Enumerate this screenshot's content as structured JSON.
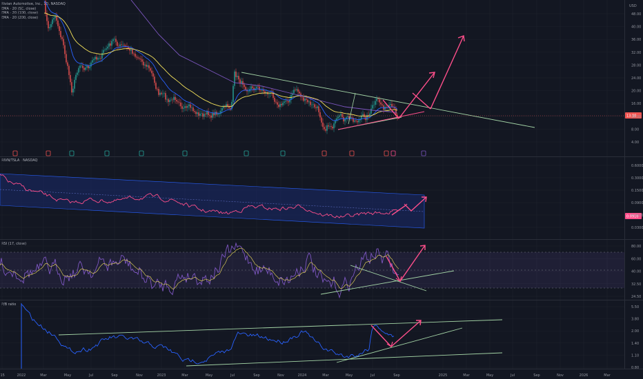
{
  "header": {
    "symbol_title": "Rivian Automotive, Inc., 1D, NASDAQ",
    "ema_20": "EMA · 20 (SC, close)",
    "ema_100": "EMA · 20 (100, close)",
    "ema_200": "EMA · 20 (200, close)",
    "currency": "USD",
    "ratio_label": "RIVN/TSLA · NASDAQ",
    "rsi_label": "RSI (17, close)",
    "pb_label": "P/B ratio"
  },
  "colors": {
    "background": "#131722",
    "grid": "#1e222d",
    "candle_up": "#26a69a",
    "candle_down": "#ef5350",
    "ema_fast": "#2962ff",
    "ema_mid": "#f5e35b",
    "ema_slow": "#7e57c2",
    "trendline": "#a5d6a7",
    "arrow": "#ff4f8b",
    "channel_fill": "#1a2a6c",
    "rsi_line": "#7e57c2",
    "pb_line": "#2962ff"
  },
  "chart_data": [
    {
      "type": "line",
      "title": "Rivian Automotive, Inc., 1D, NASDAQ",
      "ylabel": "USD",
      "y_ticks": [
        "48.00",
        "40.00",
        "36.00",
        "32.00",
        "28.00",
        "24.00",
        "20.00",
        "16.00",
        "12.00",
        "8.00",
        "4.00"
      ],
      "price_tag": "13.00",
      "x_ticks": [
        "'15",
        "2022",
        "Mar",
        "May",
        "Jul",
        "Sep",
        "Nov",
        "2023",
        "Mar",
        "May",
        "Jul",
        "Sep",
        "Nov",
        "2024",
        "Mar",
        "May",
        "Jul",
        "Sep",
        "2025",
        "Mar",
        "May",
        "Jul",
        "Sep",
        "Nov",
        "2026",
        "Mar"
      ],
      "series": [
        {
          "name": "EMA · 20 (SC, close)"
        },
        {
          "name": "EMA · 20 (100, close)"
        },
        {
          "name": "EMA · 20 (200, close)"
        }
      ]
    },
    {
      "type": "line",
      "title": "RIVN/TSLA · NASDAQ",
      "y_ticks": [
        "0.6000",
        "0.3000",
        "0.1500",
        "0.0900",
        "0.0500",
        "0.0300"
      ],
      "value_tag": "0.0910"
    },
    {
      "type": "line",
      "title": "RSI (17, close)",
      "y_ticks": [
        "80.00",
        "60.00",
        "40.00",
        "32.50",
        "24.50"
      ]
    },
    {
      "type": "line",
      "title": "P/B ratio",
      "y_ticks": [
        "5.50",
        "3.80",
        "2.00",
        "1.40",
        "1.10",
        "0.80"
      ]
    }
  ]
}
